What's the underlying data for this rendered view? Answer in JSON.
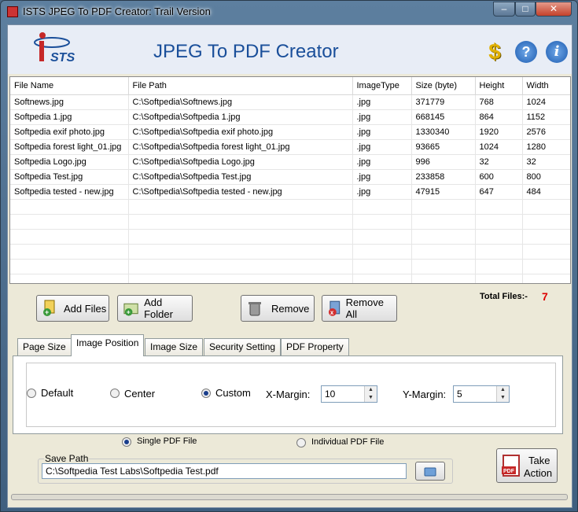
{
  "window": {
    "title": "ISTS JPEG To PDF Creator: Trail Version",
    "controls": {
      "minimize": "–",
      "maximize": "□",
      "close": "✕"
    }
  },
  "header": {
    "logo_text": "ISTS",
    "app_title": "JPEG To PDF Creator",
    "icons": [
      "dollar-icon",
      "help-icon",
      "info-icon"
    ]
  },
  "file_table": {
    "columns": [
      "File Name",
      "File Path",
      "ImageType",
      "Size (byte)",
      "Height",
      "Width"
    ],
    "rows": [
      [
        "Softnews.jpg",
        "C:\\Softpedia\\Softnews.jpg",
        ".jpg",
        "371779",
        "768",
        "1024"
      ],
      [
        "Softpedia 1.jpg",
        "C:\\Softpedia\\Softpedia 1.jpg",
        ".jpg",
        "668145",
        "864",
        "1152"
      ],
      [
        "Softpedia exif photo.jpg",
        "C:\\Softpedia\\Softpedia exif photo.jpg",
        ".jpg",
        "1330340",
        "1920",
        "2576"
      ],
      [
        "Softpedia forest light_01.jpg",
        "C:\\Softpedia\\Softpedia forest light_01.jpg",
        ".jpg",
        "93665",
        "1024",
        "1280"
      ],
      [
        "Softpedia Logo.jpg",
        "C:\\Softpedia\\Softpedia Logo.jpg",
        ".jpg",
        "996",
        "32",
        "32"
      ],
      [
        "Softpedia Test.jpg",
        "C:\\Softpedia\\Softpedia Test.jpg",
        ".jpg",
        "233858",
        "600",
        "800"
      ],
      [
        "Softpedia tested - new.jpg",
        "C:\\Softpedia\\Softpedia tested - new.jpg",
        ".jpg",
        "47915",
        "647",
        "484"
      ]
    ],
    "empty_rows": 6
  },
  "buttons": {
    "add_files": "Add Files",
    "add_folder": "Add Folder",
    "remove": "Remove",
    "remove_all": "Remove All"
  },
  "total": {
    "label": "Total Files:-",
    "value": "7"
  },
  "tabs": {
    "items": [
      "Page Size",
      "Image Position",
      "Image Size",
      "Security Setting",
      "PDF Property"
    ],
    "active": "Image Position"
  },
  "image_position": {
    "options": [
      "Default",
      "Center",
      "Custom"
    ],
    "selected": "Custom",
    "x_margin_label": "X-Margin:",
    "x_margin_value": "10",
    "y_margin_label": "Y-Margin:",
    "y_margin_value": "5"
  },
  "output_mode": {
    "single": "Single PDF File",
    "individual": "Individual PDF File",
    "selected": "Single PDF File"
  },
  "save_path": {
    "label": "Save Path",
    "value": "C:\\Softpedia Test Labs\\Softpedia Test.pdf"
  },
  "take_action": {
    "line1": "Take",
    "line2": "Action"
  },
  "colors": {
    "title_blue": "#1a4f9a",
    "total_red": "#dd0000",
    "window_bg": "#ece9d8"
  }
}
